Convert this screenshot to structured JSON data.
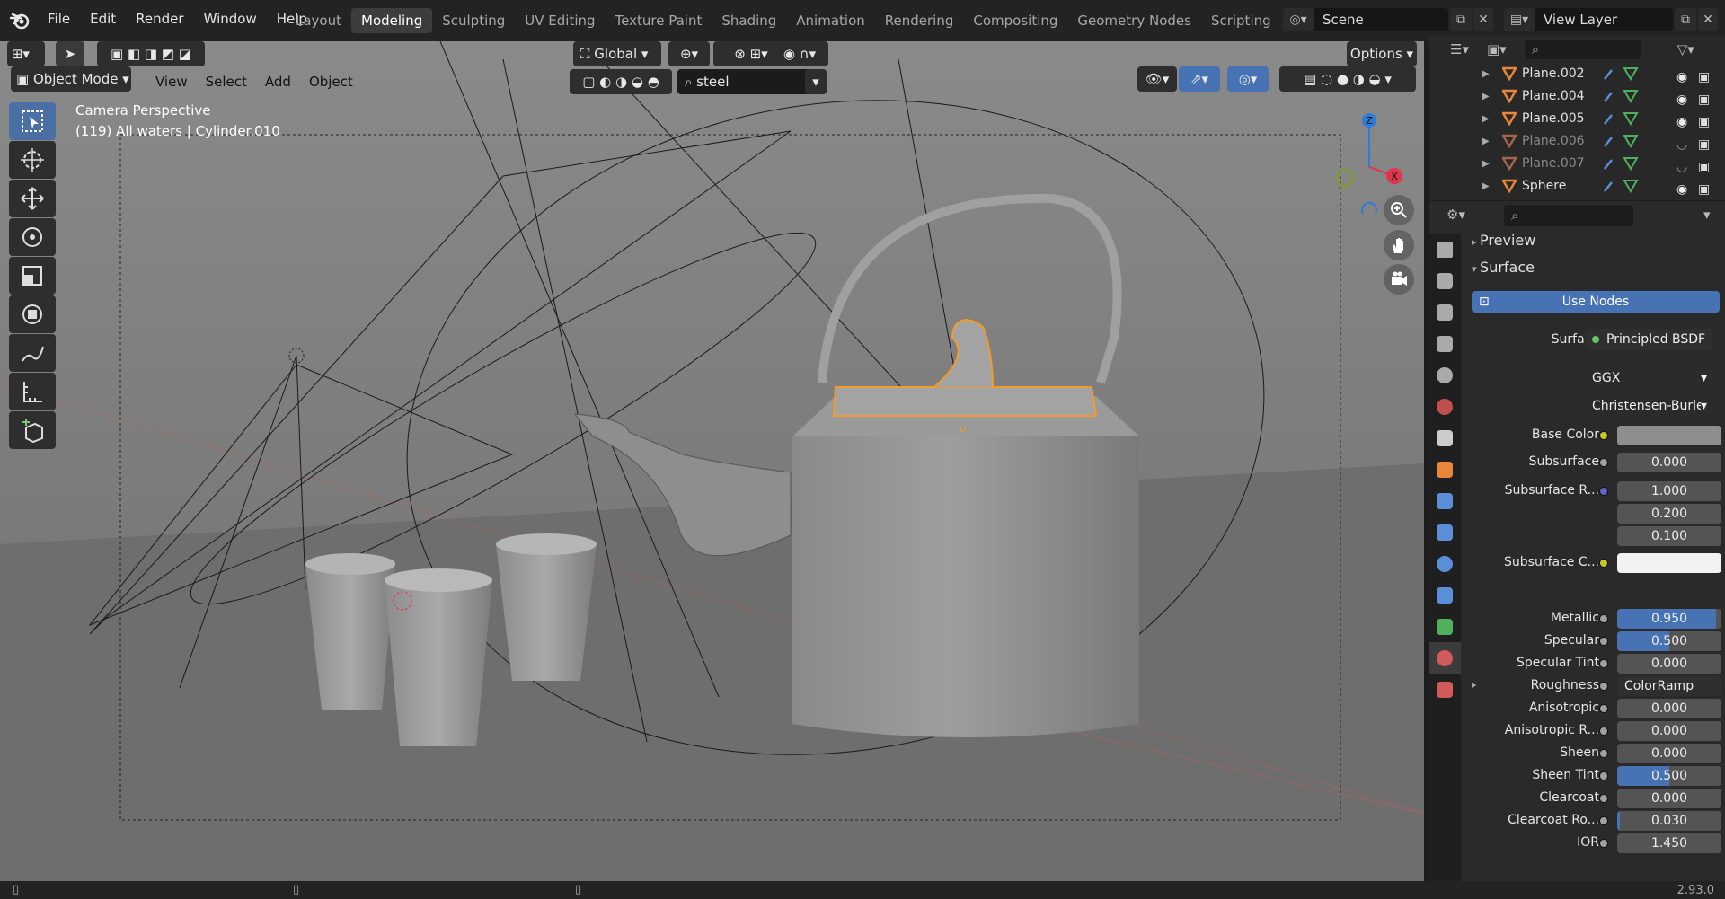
{
  "topbar": {
    "menus": [
      "File",
      "Edit",
      "Render",
      "Window",
      "Help"
    ],
    "workspaces": [
      "Layout",
      "Modeling",
      "Sculpting",
      "UV Editing",
      "Texture Paint",
      "Shading",
      "Animation",
      "Rendering",
      "Compositing",
      "Geometry Nodes",
      "Scripting"
    ],
    "active_workspace": "Modeling",
    "scene_name": "Scene",
    "view_layer": "View Layer"
  },
  "viewport": {
    "mode": "Object Mode",
    "menus": [
      "View",
      "Select",
      "Add",
      "Object"
    ],
    "orientation": "Global",
    "search_text": "steel",
    "options_label": "Options",
    "overlay_line1": "Camera Perspective",
    "overlay_line2": "(119) All waters | Cylinder.010",
    "gizmo_axes": {
      "z": "Z",
      "x": "X"
    }
  },
  "outliner": {
    "items": [
      {
        "name": "Plane.002",
        "dim": false
      },
      {
        "name": "Plane.004",
        "dim": false
      },
      {
        "name": "Plane.005",
        "dim": false
      },
      {
        "name": "Plane.006",
        "dim": true
      },
      {
        "name": "Plane.007",
        "dim": true
      },
      {
        "name": "Sphere",
        "dim": false
      }
    ]
  },
  "properties": {
    "preview_label": "Preview",
    "surface_label": "Surface",
    "use_nodes_label": "Use Nodes",
    "surface_shader_label": "Surface",
    "surface_shader": "Principled BSDF",
    "distribution": "GGX",
    "subsurface_method": "Christensen-Burle",
    "base_color_label": "Base Color",
    "subsurface_color_label": "Subsurface C...",
    "subsurface_radius_label": "Subsurface R...",
    "subsurface_radius": [
      "1.000",
      "0.200",
      "0.100"
    ],
    "fields": [
      {
        "label": "Subsurface",
        "value": "0.000",
        "fill": 0.0
      },
      {
        "label": "Metallic",
        "value": "0.950",
        "fill": 0.95
      },
      {
        "label": "Specular",
        "value": "0.500",
        "fill": 0.5
      },
      {
        "label": "Specular Tint",
        "value": "0.000",
        "fill": 0.0
      },
      {
        "label": "Roughness",
        "value": "ColorRamp",
        "fill": 0.0
      },
      {
        "label": "Anisotropic",
        "value": "0.000",
        "fill": 0.0
      },
      {
        "label": "Anisotropic R...",
        "value": "0.000",
        "fill": 0.0
      },
      {
        "label": "Sheen",
        "value": "0.000",
        "fill": 0.0
      },
      {
        "label": "Sheen Tint",
        "value": "0.500",
        "fill": 0.5
      },
      {
        "label": "Clearcoat",
        "value": "0.000",
        "fill": 0.0
      },
      {
        "label": "Clearcoat Ro...",
        "value": "0.030",
        "fill": 0.03
      },
      {
        "label": "IOR",
        "value": "1.450",
        "fill": 0.0
      }
    ]
  },
  "statusbar": {
    "version": "2.93.0"
  },
  "colors": {
    "accent": "#4772b3",
    "selection_outline": "#f39c2b",
    "x_axis": "#e0364b",
    "z_axis": "#2f7bd8",
    "y_axis": "#7ca11e"
  }
}
